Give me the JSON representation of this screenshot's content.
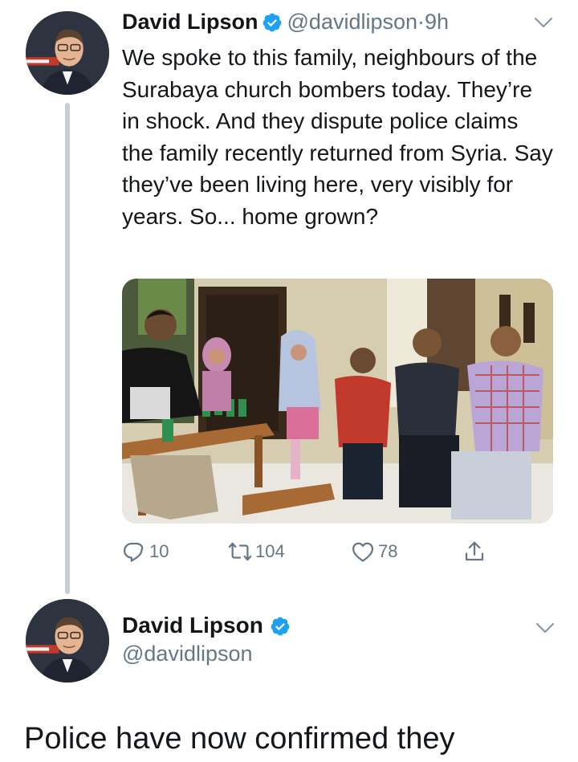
{
  "tweet": {
    "author_name": "David Lipson",
    "handle": "@davidlipson",
    "separator": "·",
    "time": "9h",
    "text": "We spoke to this family, neighbours of the Surabaya church bombers today. They’re in shock. And they dispute police claims the family recently returned from Syria. Say they’ve been living here, very visibly for years. So... home grown?",
    "actions": {
      "reply_count": "10",
      "retweet_count": "104",
      "like_count": "78"
    }
  },
  "reply_tweet": {
    "author_name": "David Lipson",
    "handle": "@davidlipson",
    "text": "Police have now confirmed they"
  },
  "colors": {
    "text": "#14171a",
    "secondary": "#657786",
    "verified": "#1da1f2",
    "thread_line": "#c4cfd6"
  },
  "icons": [
    "verified-badge-icon",
    "chevron-down-icon",
    "reply-icon",
    "retweet-icon",
    "like-icon",
    "share-icon"
  ]
}
